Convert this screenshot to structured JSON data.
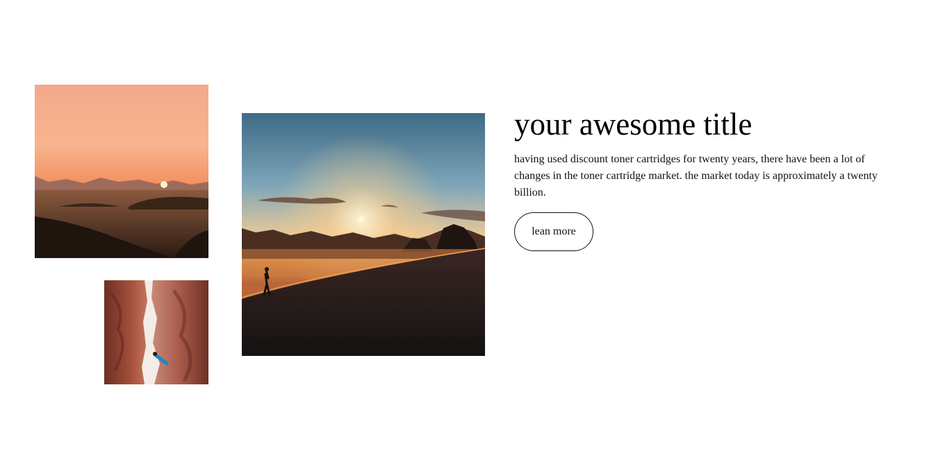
{
  "hero": {
    "title": "your awesome title",
    "description": "having used discount toner cartridges for twenty years, there have been a lot of changes in the toner cartridge market. the market today is approximately a twenty billion.",
    "button_label": "lean more"
  },
  "images": [
    {
      "subject": "desert-sunset-landscape"
    },
    {
      "subject": "narrow-red-canyon-climber"
    },
    {
      "subject": "hiker-on-desert-dune-at-sunset"
    }
  ],
  "colors": {
    "text": "#111111",
    "background": "#ffffff",
    "button_border": "#111111"
  }
}
